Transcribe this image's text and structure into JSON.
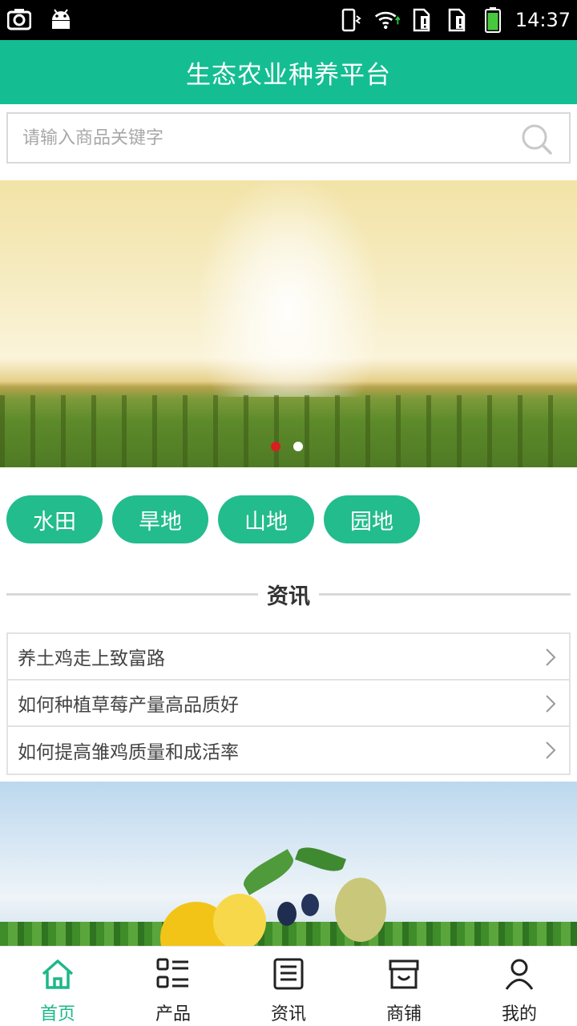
{
  "status_bar": {
    "time": "14:37",
    "left_icons": [
      "screenshot-icon",
      "android-icon"
    ],
    "right_icons": [
      "vibrate-icon",
      "wifi-icon",
      "sim1-alert-icon",
      "sim2-alert-icon",
      "battery-icon"
    ]
  },
  "header": {
    "title": "生态农业种养平台"
  },
  "search": {
    "placeholder": "请输入商品关键字",
    "value": ""
  },
  "banner": {
    "slide_count": 2,
    "active_index": 0
  },
  "categories": [
    "水田",
    "旱地",
    "山地",
    "园地"
  ],
  "section": {
    "title": "资讯"
  },
  "news": [
    "养土鸡走上致富路",
    "如何种植草莓产量高品质好",
    "如何提高雏鸡质量和成活率"
  ],
  "bottom_nav": {
    "active_index": 0,
    "tabs": [
      {
        "label": "首页",
        "icon": "home-icon"
      },
      {
        "label": "产品",
        "icon": "list-icon"
      },
      {
        "label": "资讯",
        "icon": "news-icon"
      },
      {
        "label": "商铺",
        "icon": "shop-icon"
      },
      {
        "label": "我的",
        "icon": "user-icon"
      }
    ]
  },
  "colors": {
    "brand": "#14be92",
    "pill": "#23bc8c",
    "active_dot": "#d81e1e",
    "active_tab": "#1cb88a"
  }
}
